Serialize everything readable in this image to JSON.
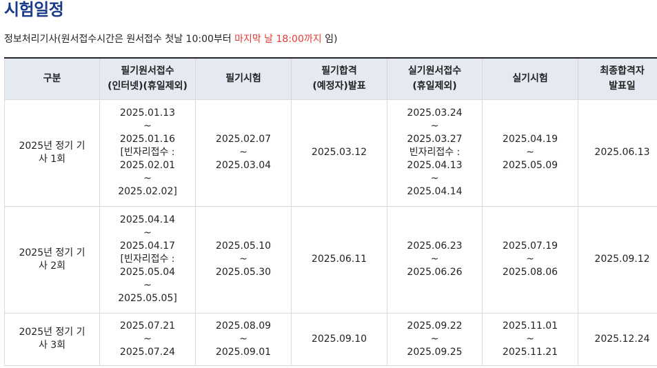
{
  "page": {
    "title": "시험일정",
    "subtitle_prefix": "정보처리기사(원서접수시간은 원서접수 첫날 10:00부터 ",
    "subtitle_highlight": "마지막 날 18:00까지",
    "subtitle_suffix": " 임)"
  },
  "colors": {
    "title": "#1a3a8a",
    "highlight": "#e53935",
    "header_bg": "#e4e9f2"
  },
  "table": {
    "headers": [
      "구분",
      "필기원서접수\n(인터넷)(휴일제외)",
      "필기시험",
      "필기합격\n(예정자)발표",
      "실기원서접수\n(휴일제외)",
      "실기시험",
      "최종합격자\n발표일"
    ],
    "rows": [
      [
        "2025년 정기 기\n사 1회",
        "2025.01.13\n~\n2025.01.16\n[빈자리접수 :\n2025.02.01\n~\n2025.02.02]",
        "2025.02.07\n~\n2025.03.04",
        "2025.03.12",
        "2025.03.24\n~\n2025.03.27\n빈자리접수 :\n2025.04.13\n~\n2025.04.14",
        "2025.04.19\n~\n2025.05.09",
        "2025.06.13"
      ],
      [
        "2025년 정기 기\n사 2회",
        "2025.04.14\n~\n2025.04.17\n[빈자리접수 :\n2025.05.04\n~\n2025.05.05]",
        "2025.05.10\n~\n2025.05.30",
        "2025.06.11",
        "2025.06.23\n~\n2025.06.26",
        "2025.07.19\n~\n2025.08.06",
        "2025.09.12"
      ],
      [
        "2025년 정기 기\n사 3회",
        "2025.07.21\n~\n2025.07.24",
        "2025.08.09\n~\n2025.09.01",
        "2025.09.10",
        "2025.09.22\n~\n2025.09.25",
        "2025.11.01\n~\n2025.11.21",
        "2025.12.24"
      ]
    ]
  }
}
